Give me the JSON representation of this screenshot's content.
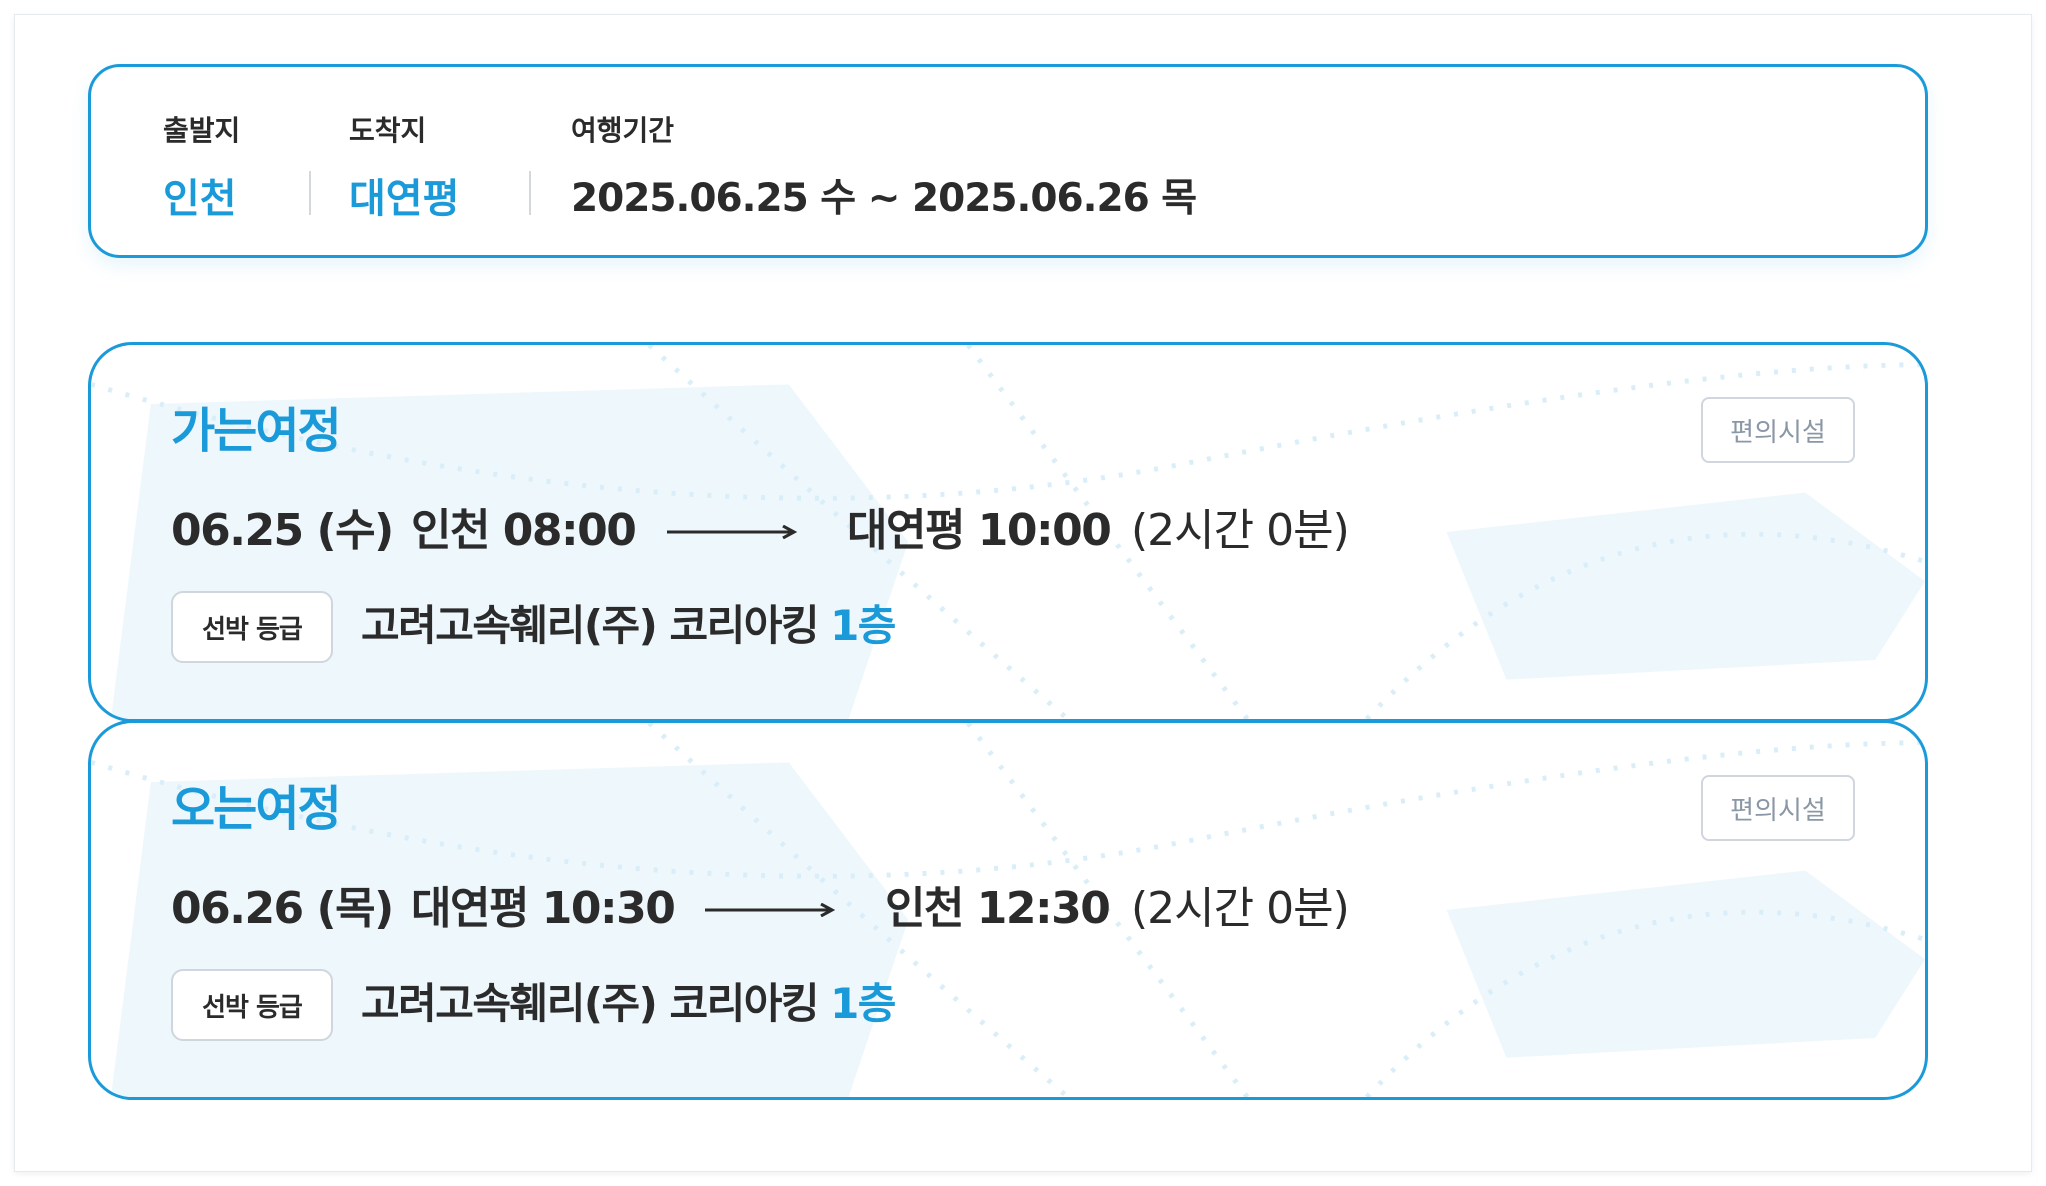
{
  "summary": {
    "departure_label": "출발지",
    "departure_value": "인천",
    "arrival_label": "도착지",
    "arrival_value": "대연평",
    "period_label": "여행기간",
    "period_value": "2025.06.25 수 ~ 2025.06.26 목"
  },
  "outbound": {
    "title": "가는여정",
    "facilities_button": "편의시설",
    "date": "06.25 (수)",
    "from": "인천 08:00",
    "to": "대연평 10:00",
    "duration": "(2시간 0분)",
    "grade_label": "선박 등급",
    "ship": "고려고속훼리(주) 코리아킹",
    "floor": "1층"
  },
  "return": {
    "title": "오는여정",
    "facilities_button": "편의시설",
    "date": "06.26 (목)",
    "from": "대연평 10:30",
    "to": "인천 12:30",
    "duration": "(2시간 0분)",
    "grade_label": "선박 등급",
    "ship": "고려고속훼리(주) 코리아킹",
    "floor": "1층"
  },
  "colors": {
    "accent": "#1b9ad9",
    "text": "#2b2b2b",
    "muted": "#8a97a6",
    "border": "#cfd6de"
  },
  "icons": {
    "arrow": "long-right-arrow-icon",
    "background": "ship-route-illustration"
  }
}
